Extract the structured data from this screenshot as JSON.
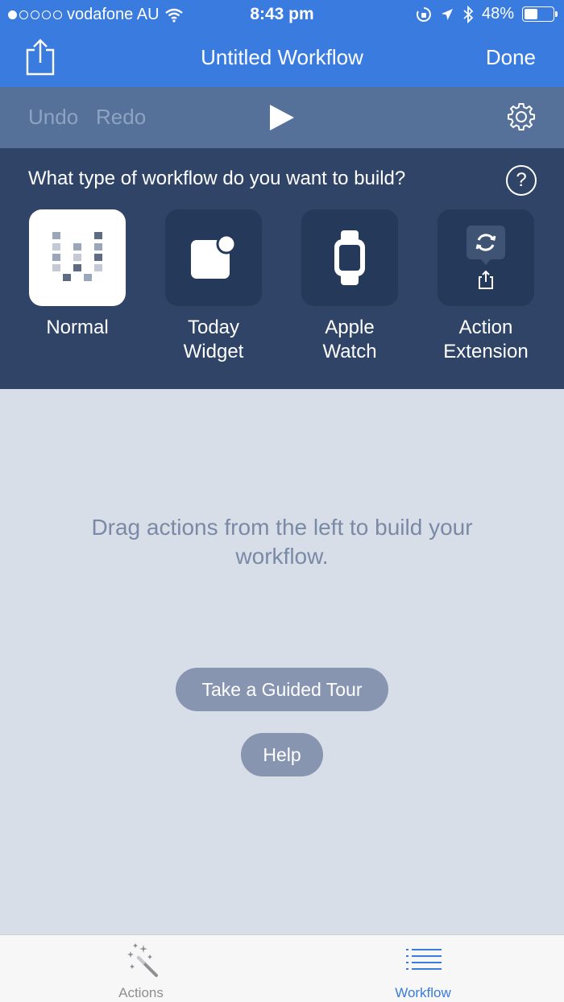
{
  "status_bar": {
    "carrier": "vodafone AU",
    "time": "8:43 pm",
    "battery": "48%",
    "battery_level": 0.48
  },
  "nav": {
    "title": "Untitled Workflow",
    "done_label": "Done"
  },
  "toolbar": {
    "undo_label": "Undo",
    "redo_label": "Redo"
  },
  "type_picker": {
    "question": "What type of workflow do you want to build?",
    "help_glyph": "?",
    "options": [
      {
        "label": "Normal",
        "icon": "workflow-grid-icon",
        "selected": true
      },
      {
        "label": "Today Widget",
        "icon": "widget-icon",
        "selected": false
      },
      {
        "label": "Apple Watch",
        "icon": "watch-icon",
        "selected": false
      },
      {
        "label": "Action Extension",
        "icon": "action-extension-icon",
        "selected": false
      }
    ]
  },
  "content": {
    "empty_message": "Drag actions from the left to build your workflow.",
    "tour_label": "Take a Guided Tour",
    "help_label": "Help"
  },
  "tabs": [
    {
      "label": "Actions",
      "icon": "magic-wand-icon",
      "active": false
    },
    {
      "label": "Workflow",
      "icon": "list-icon",
      "active": true
    }
  ],
  "colors": {
    "accent": "#3a7be0",
    "toolbar": "#55719a",
    "panel": "#2f4466",
    "tile": "#25395a",
    "background": "#d7dee8",
    "pill": "#8795b0"
  }
}
